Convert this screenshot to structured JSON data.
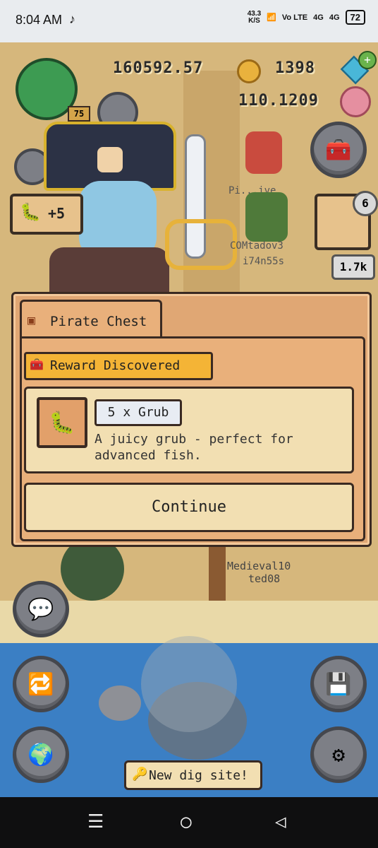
{
  "status_bar": {
    "time": "8:04 AM",
    "speed_value": "43.3",
    "speed_unit": "K/S",
    "network_1": "Vo LTE",
    "network_2": "4G",
    "network_3": "4G",
    "battery": "72"
  },
  "hud": {
    "coins": "160592.57",
    "gems": "1398",
    "rate": "110.1209",
    "level": "75",
    "boost": "+5",
    "inventory_count": "6",
    "price": "1.7k"
  },
  "players": [
    "Pi...ive",
    "COMtadov3",
    "i74n55s",
    "Medieval10",
    "ted08"
  ],
  "dialog": {
    "tab_title": "Pirate Chest",
    "badge": "Reward Discovered",
    "item_name": "5 x Grub",
    "item_description": "A juicy grub - perfect for advanced fish.",
    "continue_label": "Continue"
  },
  "banner": {
    "text": "New dig site!"
  },
  "icons": {
    "chat": "chat-icon",
    "shop": "shop-icon",
    "map": "globe-icon",
    "save": "save-icon",
    "settings": "gear-icon",
    "chest": "chest-icon"
  },
  "colors": {
    "dialog_bg": "#e0a774",
    "badge": "#f4b436",
    "water": "#3b7fc4"
  }
}
